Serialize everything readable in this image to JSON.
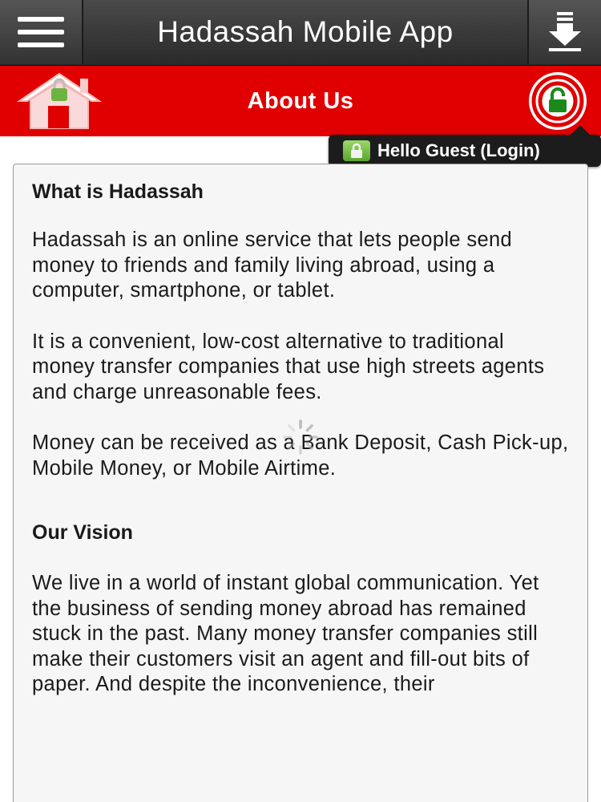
{
  "topbar": {
    "title": "Hadassah Mobile App",
    "menu_icon": "hamburger-menu-icon",
    "download_icon": "download-icon"
  },
  "header": {
    "title": "About Us",
    "home_icon": "home-icon",
    "lock_icon": "lock-icon",
    "accent_color": "#e00000"
  },
  "guest": {
    "label": "Hello Guest (Login)"
  },
  "content": {
    "heading1": "What is Hadassah",
    "para1": "Hadassah is an online service that lets people send money to friends and family living abroad, using a computer, smartphone, or tablet.",
    "para2": "It is a convenient, low-cost alternative to traditional money transfer companies that use high streets agents and charge unreasonable fees.",
    "para3": "Money can be received as a Bank Deposit, Cash Pick-up, Mobile Money, or Mobile Airtime.",
    "heading2": "Our Vision",
    "para4": "We live in a world of instant global communication. Yet the business of sending money abroad has remained stuck in the past. Many money transfer companies still make their customers visit an agent and fill-out bits of paper. And despite the inconvenience, their"
  }
}
